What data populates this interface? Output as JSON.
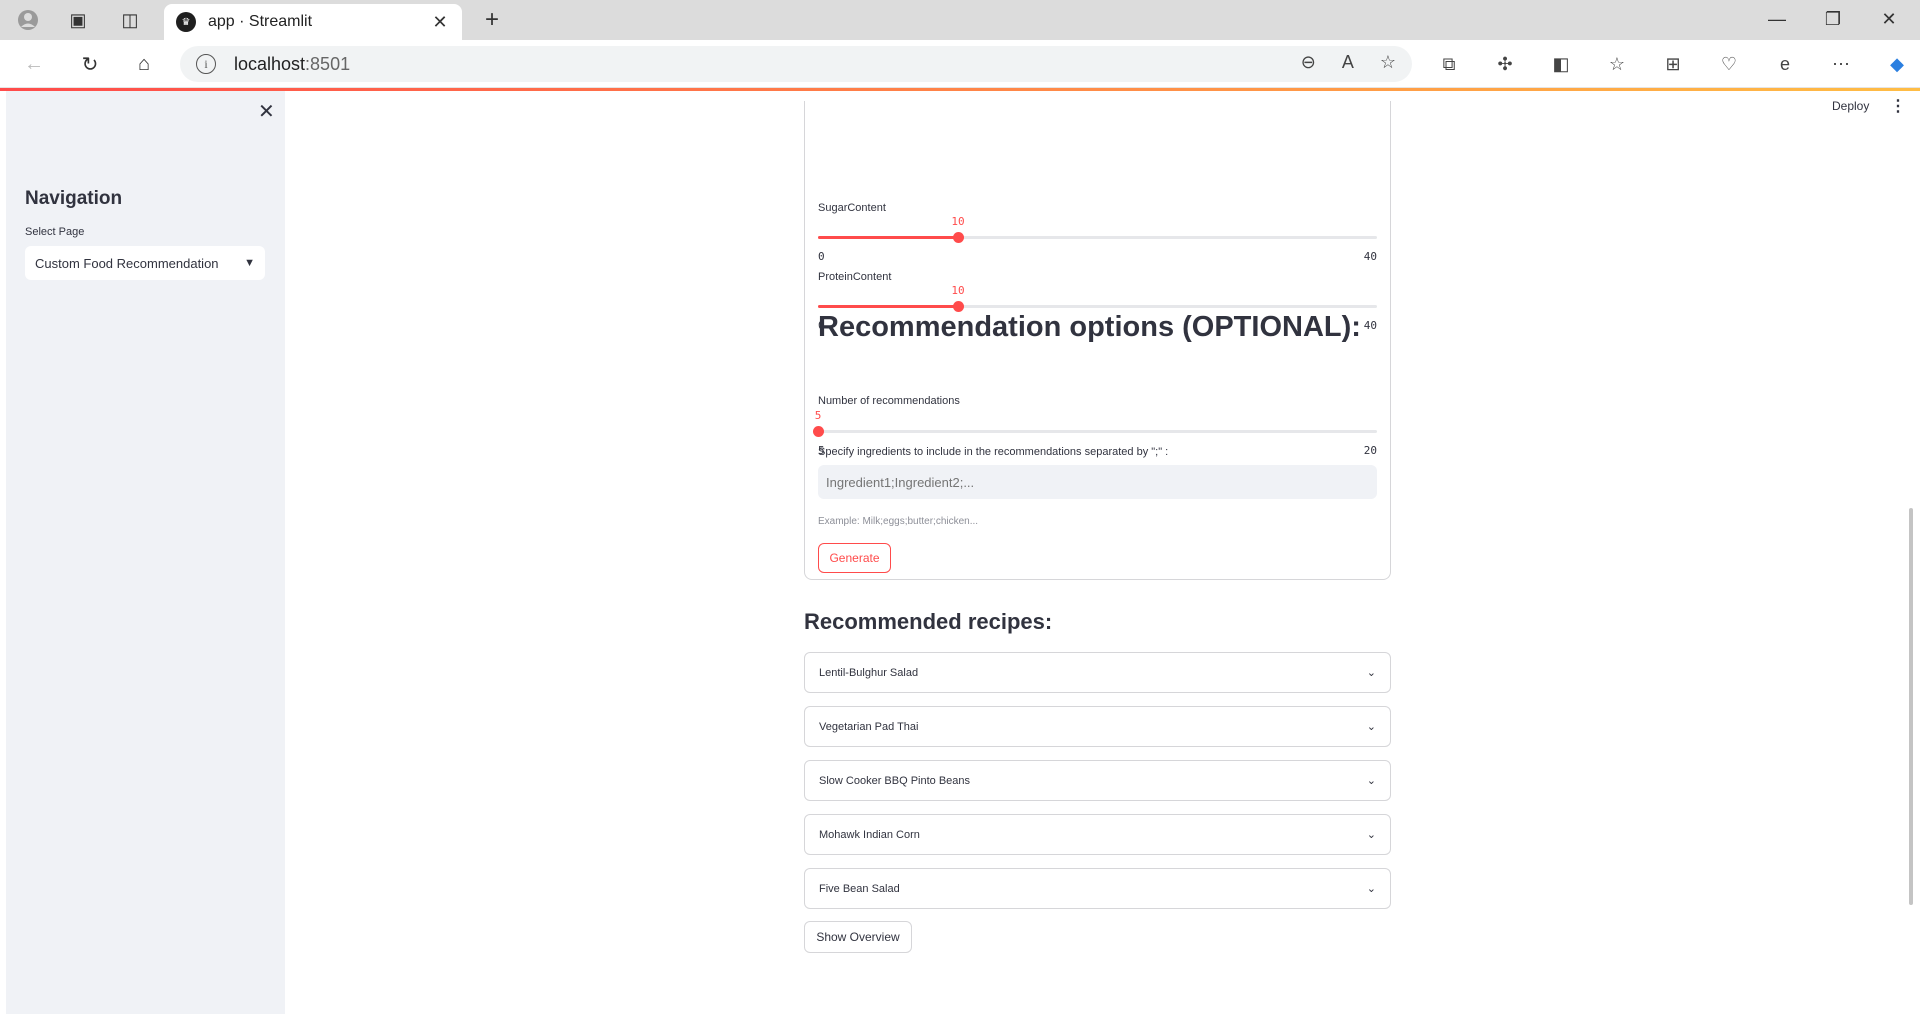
{
  "browser": {
    "tab_title": "app · Streamlit",
    "url_host": "localhost",
    "url_port": ":8501"
  },
  "header": {
    "deploy_label": "Deploy"
  },
  "sidebar": {
    "heading": "Navigation",
    "select_label": "Select Page",
    "select_value": "Custom Food Recommendation"
  },
  "sliders": [
    {
      "label": "SugarContent",
      "value": "10",
      "min": "0",
      "max": "40",
      "fraction": 0.25
    },
    {
      "label": "ProteinContent",
      "value": "10",
      "min": "0",
      "max": "40",
      "fraction": 0.25
    },
    {
      "label": "Number of recommendations",
      "value": "5",
      "min": "5",
      "max": "20",
      "fraction": 0
    }
  ],
  "options": {
    "title": "Recommendation options (OPTIONAL):",
    "ingredients_label": "Specify ingredients to include in the recommendations separated by \";\" :",
    "ingredients_placeholder": "Ingredient1;Ingredient2;...",
    "help_text": "Example: Milk;eggs;butter;chicken...",
    "generate_label": "Generate"
  },
  "results": {
    "title": "Recommended recipes:",
    "recipes": [
      "Lentil-Bulghur Salad",
      "Vegetarian Pad Thai",
      "Slow Cooker BBQ Pinto Beans",
      "Mohawk Indian Corn",
      "Five Bean Salad"
    ],
    "overview_label": "Show Overview"
  },
  "colors": {
    "accent": "#ff4b4b",
    "sidebar_bg": "#f0f2f6",
    "text": "#31333f"
  }
}
